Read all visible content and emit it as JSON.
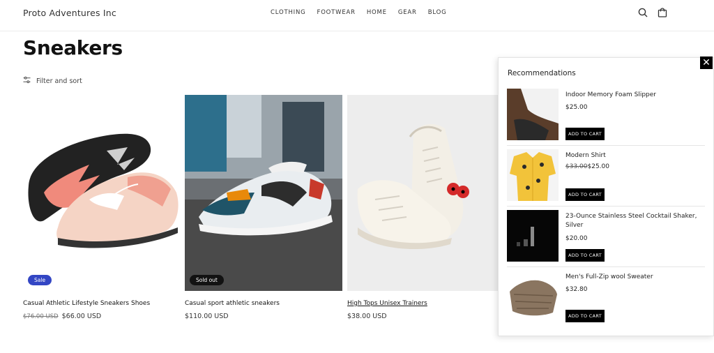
{
  "header": {
    "brand": "Proto Adventures Inc",
    "nav": [
      "CLOTHING",
      "FOOTWEAR",
      "HOME",
      "GEAR",
      "BLOG"
    ],
    "icons": [
      "search-icon",
      "cart-icon"
    ]
  },
  "page": {
    "title": "Sneakers",
    "filter_label": "Filter and sort"
  },
  "products": [
    {
      "title": "Casual Athletic Lifestyle Sneakers Shoes",
      "compare_price": "$76.00 USD",
      "price": "$66.00 USD",
      "badge": "Sale"
    },
    {
      "title": "Casual sport athletic sneakers",
      "compare_price": "",
      "price": "$110.00 USD",
      "badge": "Sold out"
    },
    {
      "title": "High Tops Unisex Trainers",
      "compare_price": "",
      "price": "$38.00 USD",
      "badge": ""
    }
  ],
  "recommendations": {
    "title": "Recommendations",
    "close": "✕",
    "items": [
      {
        "name": "Indoor Memory Foam Slipper",
        "compare_price": "",
        "price": "$25.00",
        "button": "ADD TO CART"
      },
      {
        "name": "Modern Shirt",
        "compare_price": "$33.00",
        "price": "$25.00",
        "button": "ADD TO CART"
      },
      {
        "name": "23-Ounce Stainless Steel Cocktail Shaker, Silver",
        "compare_price": "",
        "price": "$20.00",
        "button": "ADD TO CART"
      },
      {
        "name": "Men's Full-Zip wool Sweater",
        "compare_price": "",
        "price": "$32.80",
        "button": "ADD TO CART"
      }
    ]
  },
  "colors": {
    "sale_badge": "#3346c4",
    "sold_badge": "#121212",
    "button": "#000000"
  }
}
